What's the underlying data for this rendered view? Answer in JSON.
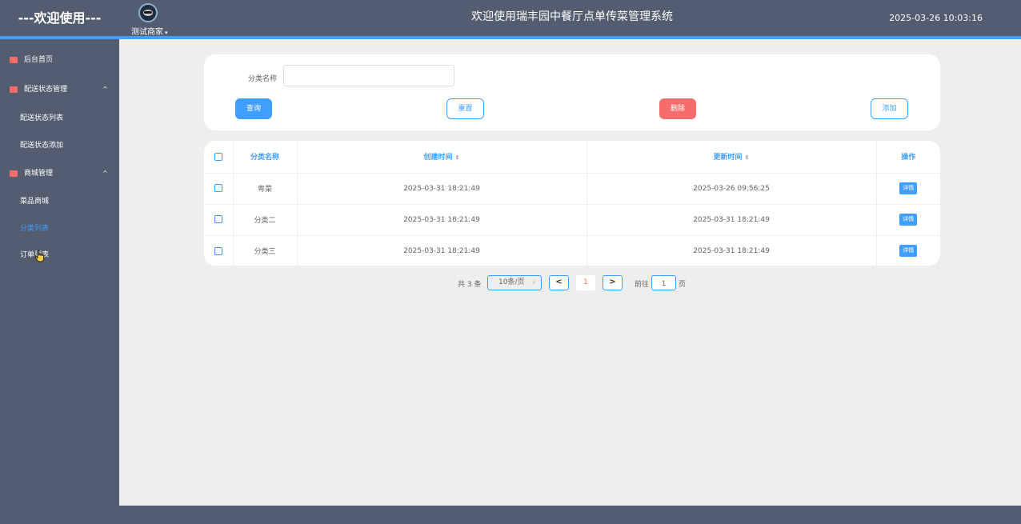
{
  "header": {
    "brand": "---欢迎使用---",
    "user_name": "测试商家",
    "user_caret": "▾",
    "system_title": "欢迎使用瑞丰园中餐厅点单传菜管理系统",
    "datetime": "2025-03-26 10:03:16"
  },
  "sidebar": {
    "items": [
      {
        "label": "后台首页",
        "icon": "monitor-icon",
        "color": "#f56c6c"
      },
      {
        "label": "配送状态管理",
        "icon": "chart-icon",
        "color": "#f56c6c",
        "arrow": "^"
      },
      {
        "label": "配送状态列表"
      },
      {
        "label": "配送状态添加"
      },
      {
        "label": "商城管理",
        "icon": "monitor-icon",
        "color": "#f56c6c",
        "arrow": "^"
      },
      {
        "label": "菜品商城"
      },
      {
        "label": "分类列表",
        "active": true
      },
      {
        "label": "订单列表"
      }
    ]
  },
  "search": {
    "field_label": "分类名称",
    "field_value": "",
    "field_placeholder": "",
    "query_label": "查询",
    "reset_label": "重置",
    "delete_label": "删除",
    "add_label": "添加"
  },
  "table": {
    "headers": [
      "分类名称",
      "创建时间",
      "更新时间",
      "操作"
    ],
    "sort_glyph": "⇕",
    "detail_label": "详情",
    "rows": [
      {
        "name": "粤菜",
        "created": "2025-03-31 18:21:49",
        "updated": "2025-03-26 09:56:25"
      },
      {
        "name": "分类二",
        "created": "2025-03-31 18:21:49",
        "updated": "2025-03-31 18:21:49"
      },
      {
        "name": "分类三",
        "created": "2025-03-31 18:21:49",
        "updated": "2025-03-31 18:21:49"
      }
    ]
  },
  "pagination": {
    "total_text": "共 3 条",
    "page_size": "10条/页",
    "dropdown_glyph": "∨",
    "prev_glyph": "<",
    "next_glyph": ">",
    "current_page": "1",
    "goto_label": "前往",
    "goto_value": "1",
    "page_unit": "页"
  },
  "colors": {
    "primary": "#409eff",
    "danger": "#f56c6c",
    "chrome": "#545c6f"
  }
}
